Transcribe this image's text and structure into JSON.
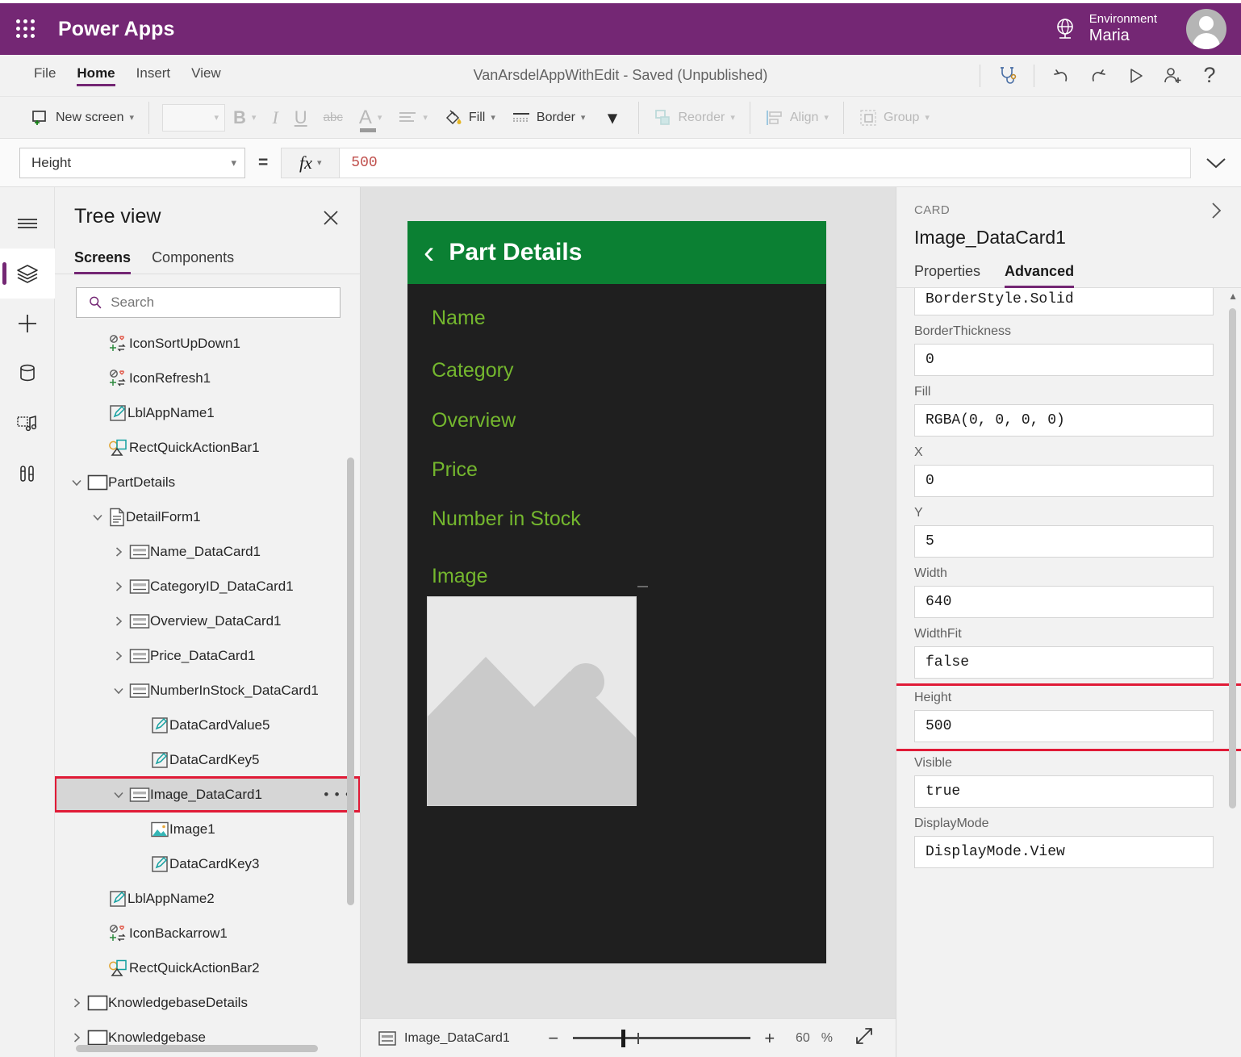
{
  "topbar": {
    "brand": "Power Apps",
    "waffle_icon": "waffle-grid-icon",
    "globe_icon": "globe-icon",
    "environment_label": "Environment",
    "environment_name": "Maria",
    "avatar_icon": "user-avatar-icon",
    "bg_color": "#742774"
  },
  "menu": {
    "items": [
      {
        "label": "File",
        "active": false
      },
      {
        "label": "Home",
        "active": true
      },
      {
        "label": "Insert",
        "active": false
      },
      {
        "label": "View",
        "active": false
      }
    ],
    "app_title": "VanArsdelAppWithEdit - Saved (Unpublished)",
    "right_buttons": [
      {
        "name": "app-checker-icon",
        "glyph": "stethoscope"
      },
      {
        "name": "undo-icon",
        "glyph": "undo"
      },
      {
        "name": "redo-icon",
        "glyph": "redo"
      },
      {
        "name": "preview-play-icon",
        "glyph": "play"
      },
      {
        "name": "share-user-icon",
        "glyph": "person-add"
      },
      {
        "name": "help-icon",
        "glyph": "?"
      }
    ]
  },
  "ribbon": {
    "new_screen": "New screen",
    "font_value": "",
    "bold": "B",
    "italic": "I",
    "underline": "U",
    "strikethrough": "abc",
    "font_color": "A",
    "align": "align-icon",
    "fill": "Fill",
    "border": "Border",
    "more": "more-chevron",
    "reorder": "Reorder",
    "align_label": "Align",
    "group": "Group"
  },
  "formula_bar": {
    "property": "Height",
    "equals": "=",
    "fx": "fx",
    "value": "500",
    "expand_icon": "chevron-down-icon"
  },
  "rail": {
    "items": [
      {
        "name": "hamburger-menu-icon",
        "selected": false
      },
      {
        "name": "tree-view-layers-icon",
        "selected": true
      },
      {
        "name": "insert-plus-icon",
        "selected": false
      },
      {
        "name": "data-sources-icon",
        "selected": false
      },
      {
        "name": "media-icon",
        "selected": false
      },
      {
        "name": "advanced-tools-icon",
        "selected": false
      }
    ]
  },
  "tree_view": {
    "title": "Tree view",
    "close_icon": "close-icon",
    "tabs": [
      {
        "label": "Screens",
        "active": true
      },
      {
        "label": "Components",
        "active": false
      }
    ],
    "search_placeholder": "Search",
    "search_value": "",
    "search_icon": "search-icon",
    "items": [
      {
        "label": "IconSortUpDown1",
        "indent": 1,
        "twisty": "",
        "icon": "icon-control-icon",
        "selected": false
      },
      {
        "label": "IconRefresh1",
        "indent": 1,
        "twisty": "",
        "icon": "icon-control-icon",
        "selected": false
      },
      {
        "label": "LblAppName1",
        "indent": 1,
        "twisty": "",
        "icon": "label-icon",
        "selected": false
      },
      {
        "label": "RectQuickActionBar1",
        "indent": 1,
        "twisty": "",
        "icon": "shape-icon",
        "selected": false
      },
      {
        "label": "PartDetails",
        "indent": 0,
        "twisty": "expanded",
        "icon": "screen-icon",
        "selected": false
      },
      {
        "label": "DetailForm1",
        "indent": 1,
        "twisty": "expanded",
        "icon": "form-icon",
        "selected": false
      },
      {
        "label": "Name_DataCard1",
        "indent": 2,
        "twisty": "collapsed",
        "icon": "datacard-icon",
        "selected": false
      },
      {
        "label": "CategoryID_DataCard1",
        "indent": 2,
        "twisty": "collapsed",
        "icon": "datacard-icon",
        "selected": false
      },
      {
        "label": "Overview_DataCard1",
        "indent": 2,
        "twisty": "collapsed",
        "icon": "datacard-icon",
        "selected": false
      },
      {
        "label": "Price_DataCard1",
        "indent": 2,
        "twisty": "collapsed",
        "icon": "datacard-icon",
        "selected": false
      },
      {
        "label": "NumberInStock_DataCard1",
        "indent": 2,
        "twisty": "expanded",
        "icon": "datacard-icon",
        "selected": false
      },
      {
        "label": "DataCardValue5",
        "indent": 3,
        "twisty": "",
        "icon": "label-icon",
        "selected": false
      },
      {
        "label": "DataCardKey5",
        "indent": 3,
        "twisty": "",
        "icon": "label-icon",
        "selected": false
      },
      {
        "label": "Image_DataCard1",
        "indent": 2,
        "twisty": "expanded",
        "icon": "datacard-icon",
        "selected": true,
        "overflow": "• • •"
      },
      {
        "label": "Image1",
        "indent": 3,
        "twisty": "",
        "icon": "image-icon",
        "selected": false
      },
      {
        "label": "DataCardKey3",
        "indent": 3,
        "twisty": "",
        "icon": "label-icon",
        "selected": false
      },
      {
        "label": "LblAppName2",
        "indent": 1,
        "twisty": "",
        "icon": "label-icon",
        "selected": false
      },
      {
        "label": "IconBackarrow1",
        "indent": 1,
        "twisty": "",
        "icon": "icon-control-icon",
        "selected": false
      },
      {
        "label": "RectQuickActionBar2",
        "indent": 1,
        "twisty": "",
        "icon": "shape-icon",
        "selected": false
      },
      {
        "label": "KnowledgebaseDetails",
        "indent": 0,
        "twisty": "collapsed",
        "icon": "screen-icon",
        "selected": false
      },
      {
        "label": "Knowledgebase",
        "indent": 0,
        "twisty": "collapsed",
        "icon": "screen-icon",
        "selected": false
      }
    ]
  },
  "canvas": {
    "app_screen": {
      "header_title": "Part Details",
      "header_bg": "#0b8033",
      "back_icon": "back-chevron-icon",
      "body_bg": "#1f1f1f",
      "label_color": "#74b72e",
      "fields": [
        "Name",
        "Category",
        "Overview",
        "Price",
        "Number in Stock",
        "Image"
      ],
      "image_placeholder_icon": "image-placeholder-icon"
    }
  },
  "status_bar": {
    "selected_control": "Image_DataCard1",
    "selected_icon": "datacard-icon",
    "zoom_out": "−",
    "zoom_in": "+",
    "zoom_value": "60",
    "zoom_unit": "%",
    "fit_icon": "fit-to-screen-icon"
  },
  "properties_panel": {
    "kicker": "CARD",
    "name": "Image_DataCard1",
    "collapse_icon": "chevron-right-icon",
    "tabs": [
      {
        "label": "Properties",
        "active": false
      },
      {
        "label": "Advanced",
        "active": true
      }
    ],
    "fields": [
      {
        "label": "",
        "value": "BorderStyle.Solid",
        "highlighted": false
      },
      {
        "label": "BorderThickness",
        "value": "0",
        "highlighted": false
      },
      {
        "label": "Fill",
        "value": "RGBA(0, 0, 0, 0)",
        "highlighted": false
      },
      {
        "label": "X",
        "value": "0",
        "highlighted": false
      },
      {
        "label": "Y",
        "value": "5",
        "highlighted": false
      },
      {
        "label": "Width",
        "value": "640",
        "highlighted": false
      },
      {
        "label": "WidthFit",
        "value": "false",
        "highlighted": false
      },
      {
        "label": "Height",
        "value": "500",
        "highlighted": true
      },
      {
        "label": "Visible",
        "value": "true",
        "highlighted": false
      },
      {
        "label": "DisplayMode",
        "value": "DisplayMode.View",
        "highlighted": false
      }
    ]
  },
  "accent_colors": {
    "brand_purple": "#742774",
    "highlight_red": "#e01b37",
    "app_green": "#0b8033",
    "label_green": "#74b72e",
    "formula_orange": "#c0504d"
  }
}
